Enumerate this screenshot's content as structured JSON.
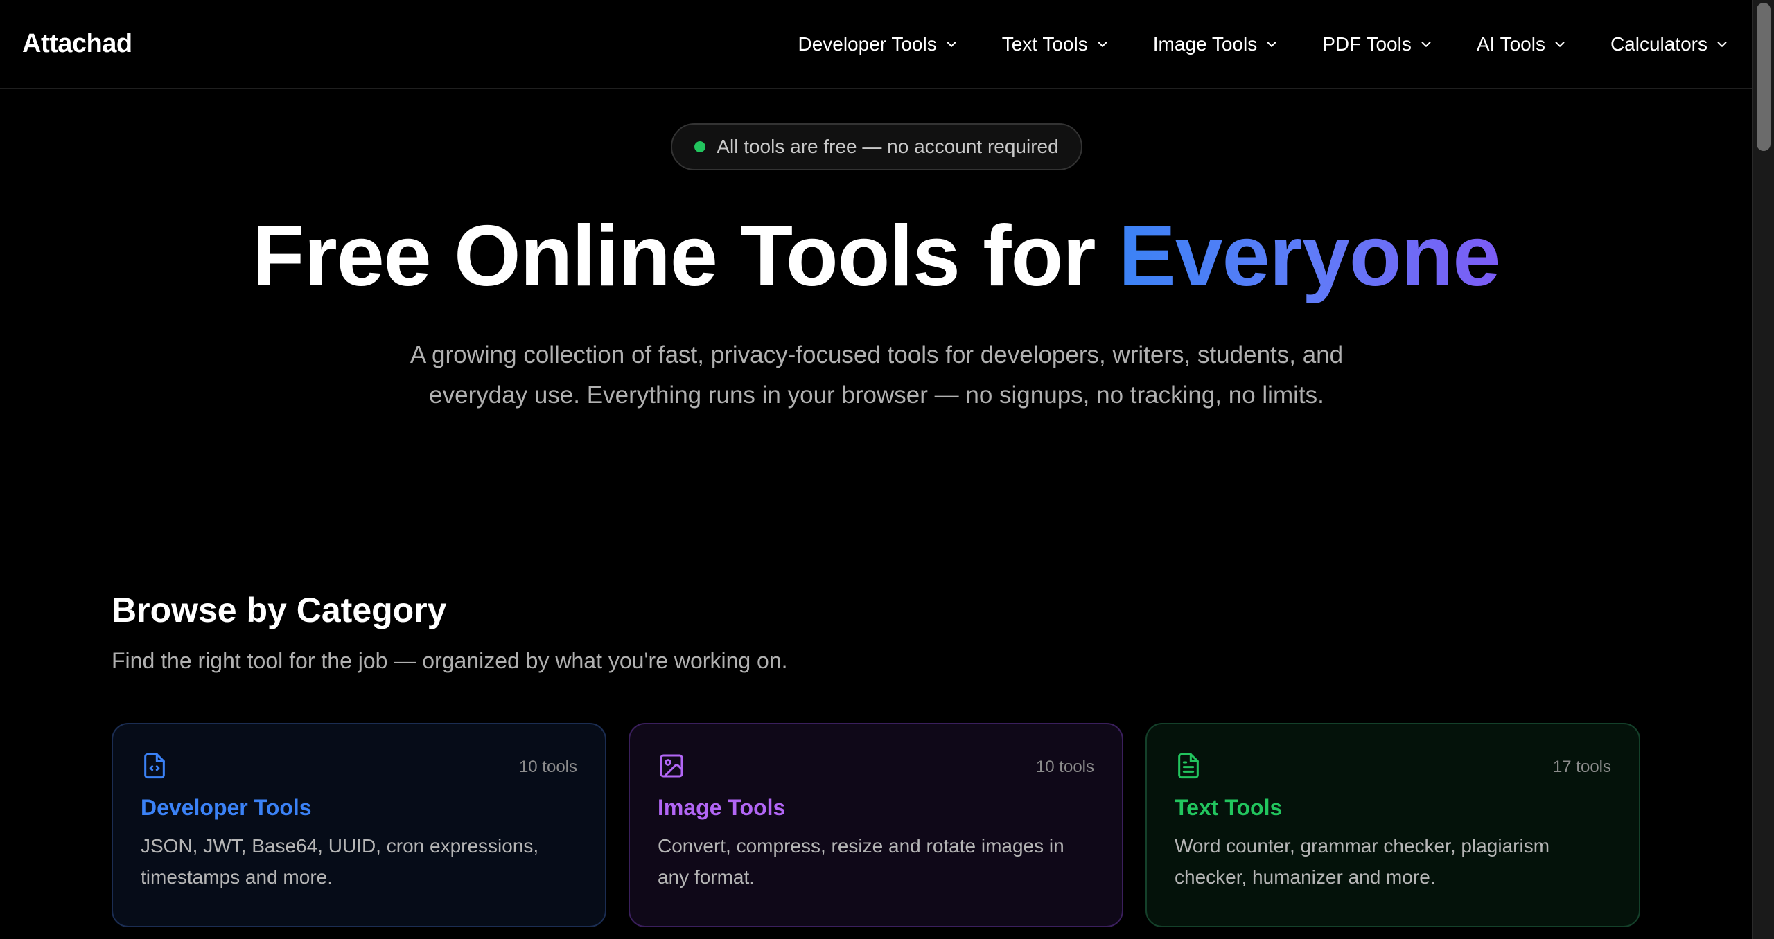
{
  "header": {
    "logo": "Attachad",
    "nav": [
      {
        "label": "Developer Tools"
      },
      {
        "label": "Text Tools"
      },
      {
        "label": "Image Tools"
      },
      {
        "label": "PDF Tools"
      },
      {
        "label": "AI Tools"
      },
      {
        "label": "Calculators"
      }
    ]
  },
  "hero": {
    "badge": "All tools are free — no account required",
    "title_main": "Free Online Tools for ",
    "title_accent": "Everyone",
    "subtitle": "A growing collection of fast, privacy-focused tools for developers, writers, students, and everyday use. Everything runs in your browser — no signups, no tracking, no limits."
  },
  "browse": {
    "title": "Browse by Category",
    "subtitle": "Find the right tool for the job — organized by what you're working on.",
    "cards": [
      {
        "icon": "file-code-icon",
        "count": "10 tools",
        "title": "Developer Tools",
        "desc": "JSON, JWT, Base64, UUID, cron expressions, timestamps and more.",
        "accent": "#3b82f6"
      },
      {
        "icon": "image-icon",
        "count": "10 tools",
        "title": "Image Tools",
        "desc": "Convert, compress, resize and rotate images in any format.",
        "accent": "#b266f5"
      },
      {
        "icon": "file-text-icon",
        "count": "17 tools",
        "title": "Text Tools",
        "desc": "Word counter, grammar checker, plagiarism checker, humanizer and more.",
        "accent": "#22c55e"
      }
    ]
  },
  "colors": {
    "background": "#000000",
    "badge_dot": "#22c55e"
  }
}
